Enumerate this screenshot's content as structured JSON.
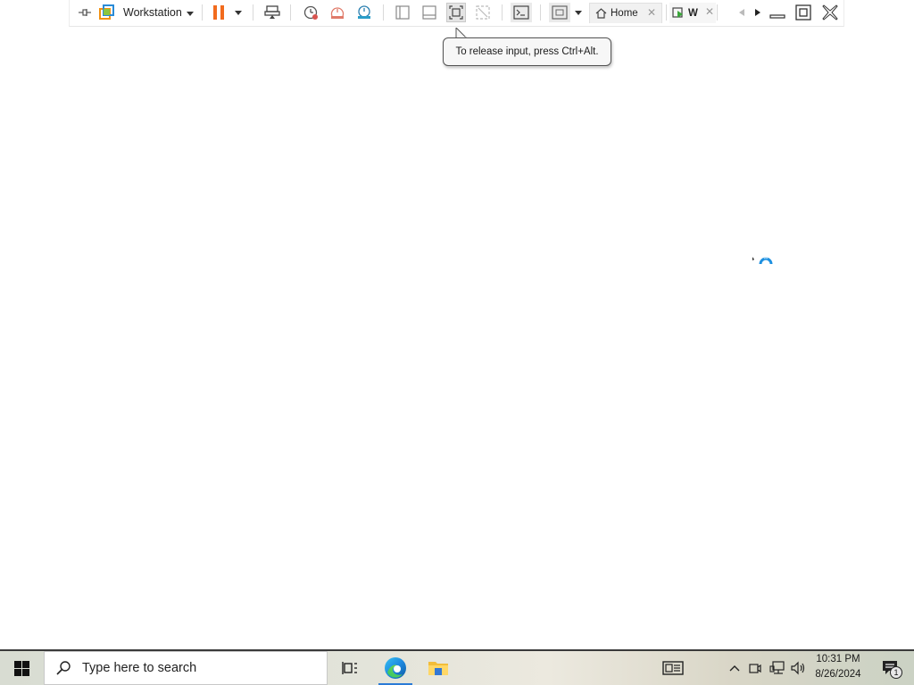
{
  "toolbar": {
    "pin_icon": "pin-icon",
    "app_icon": "vmware-workstation-icon",
    "workstation_label": "Workstation",
    "pause_color": "#f26b1d",
    "tabs": [
      {
        "label": "Home",
        "icon": "home-icon"
      },
      {
        "label": "W",
        "icon": "vm-tab-icon"
      }
    ]
  },
  "tooltip": {
    "text": "To release input, press Ctrl+Alt."
  },
  "taskbar": {
    "search_placeholder": "Type here to search",
    "clock_time": "10:31 PM",
    "clock_date": "8/26/2024",
    "notification_count": "1",
    "accent_color": "#2b7bd6"
  }
}
